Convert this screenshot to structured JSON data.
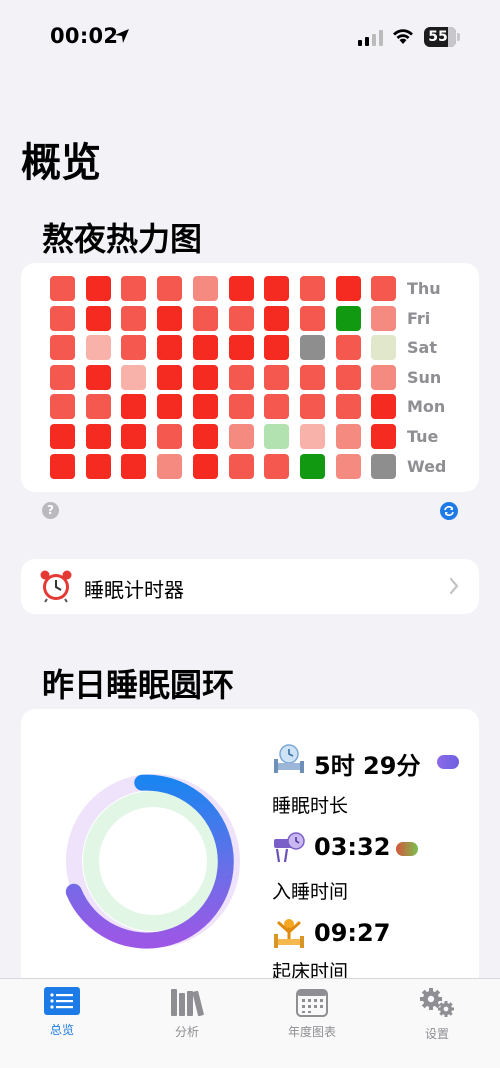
{
  "status_bar": {
    "time": "00:02",
    "battery": "55"
  },
  "page_title": "概览",
  "heatmap": {
    "title": "熬夜热力图",
    "days": [
      "Thu",
      "Fri",
      "Sat",
      "Sun",
      "Mon",
      "Tue",
      "Wed"
    ],
    "colors": {
      "R": "#f52a20",
      "M": "#f5584e",
      "L": "#f58a80",
      "P": "#f8b2aa",
      "G": "#119a11",
      "LG": "#b2e2b0",
      "GR": "#8e8e8e",
      "Y": "#e1e7cb"
    },
    "grid": [
      [
        "M",
        "R",
        "M",
        "M",
        "L",
        "R",
        "R",
        "M",
        "R",
        "M"
      ],
      [
        "M",
        "R",
        "M",
        "R",
        "M",
        "M",
        "R",
        "M",
        "G",
        "L"
      ],
      [
        "M",
        "P",
        "M",
        "R",
        "R",
        "R",
        "R",
        "GR",
        "M",
        "Y"
      ],
      [
        "M",
        "R",
        "P",
        "R",
        "R",
        "M",
        "M",
        "M",
        "M",
        "L"
      ],
      [
        "M",
        "M",
        "R",
        "R",
        "R",
        "M",
        "M",
        "M",
        "M",
        "R"
      ],
      [
        "R",
        "R",
        "R",
        "M",
        "R",
        "L",
        "LG",
        "P",
        "L",
        "R"
      ],
      [
        "R",
        "R",
        "R",
        "L",
        "R",
        "M",
        "M",
        "G",
        "L",
        "GR"
      ]
    ]
  },
  "help_icon": "?",
  "timer": {
    "label": "睡眠计时器"
  },
  "ring": {
    "title": "昨日睡眠圆环",
    "duration": {
      "value": "5时 29分",
      "label": "睡眠时长"
    },
    "bedtime": {
      "value": "03:32",
      "label": "入睡时间"
    },
    "waketime": {
      "value": "09:27",
      "label": "起床时间"
    }
  },
  "tabs": [
    {
      "label": "总览",
      "active": true
    },
    {
      "label": "分析",
      "active": false
    },
    {
      "label": "年度图表",
      "active": false
    },
    {
      "label": "设置",
      "active": false
    }
  ]
}
